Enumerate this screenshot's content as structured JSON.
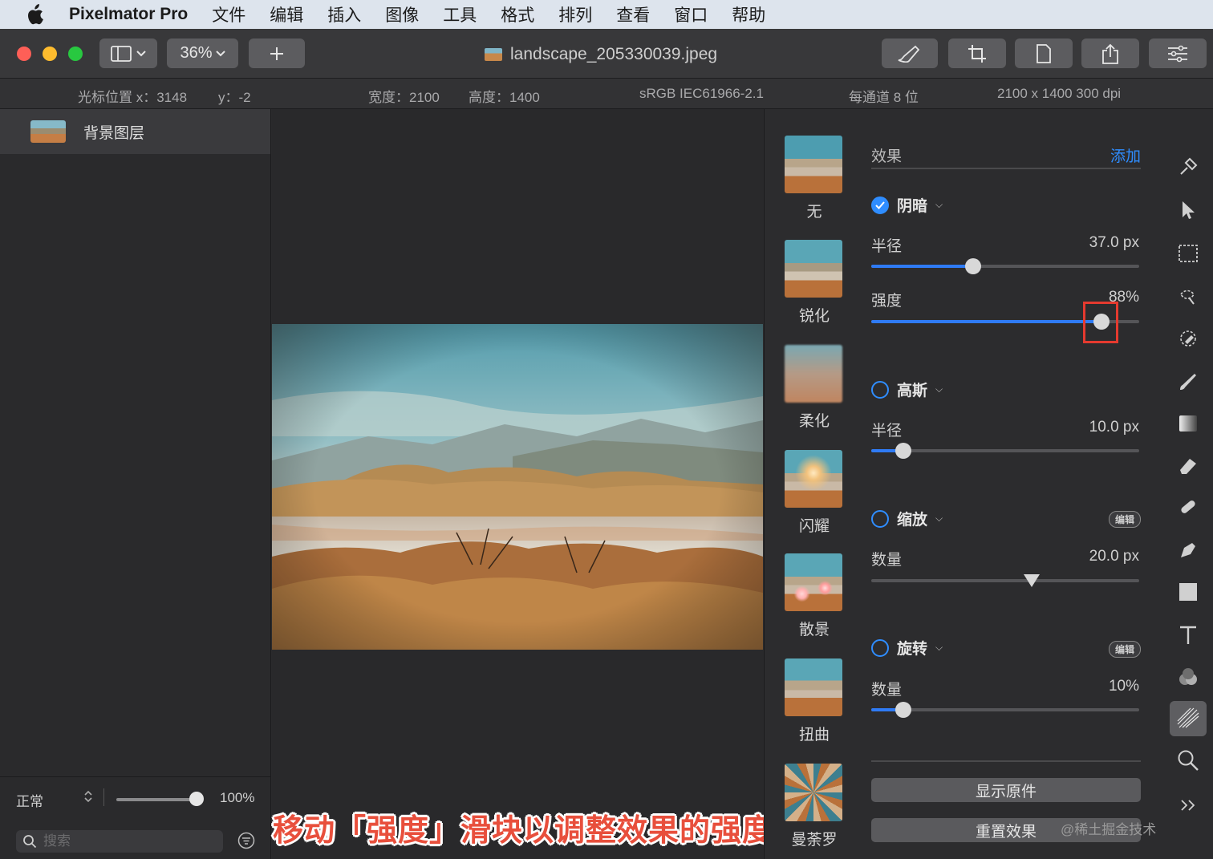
{
  "menubar": {
    "app_name": "Pixelmator Pro",
    "items": [
      "文件",
      "编辑",
      "插入",
      "图像",
      "工具",
      "格式",
      "排列",
      "查看",
      "窗口",
      "帮助"
    ]
  },
  "toolbar": {
    "zoom": "36%",
    "document_title": "landscape_205330039.jpeg"
  },
  "infobar": {
    "cursor_x": "光标位置 x：3148",
    "cursor_y": "y：-2",
    "width": "宽度：2100",
    "height": "高度：1400",
    "color_profile": "sRGB IEC61966-2.1",
    "bit_depth": "每通道 8 位",
    "dimensions": "2100 x 1400 300 dpi"
  },
  "layers": {
    "items": [
      {
        "name": "背景图层"
      }
    ],
    "blend_mode": "正常",
    "opacity": "100%",
    "opacity_value": 1.0,
    "search_placeholder": "搜索"
  },
  "effects_browser": {
    "items": [
      "无",
      "锐化",
      "柔化",
      "闪耀",
      "散景",
      "扭曲",
      "曼荼罗"
    ]
  },
  "effects_panel": {
    "title": "效果",
    "add_label": "添加",
    "effects": [
      {
        "name": "阴暗",
        "enabled": true,
        "params": [
          {
            "label": "半径",
            "value": "37.0 px",
            "fraction": 0.38
          },
          {
            "label": "强度",
            "value": "88%",
            "fraction": 0.86
          }
        ]
      },
      {
        "name": "高斯",
        "enabled": false,
        "params": [
          {
            "label": "半径",
            "value": "10.0 px",
            "fraction": 0.12
          }
        ]
      },
      {
        "name": "缩放",
        "enabled": false,
        "edit_label": "编辑",
        "params": [
          {
            "label": "数量",
            "value": "20.0 px",
            "fraction": 0.6
          }
        ]
      },
      {
        "name": "旋转",
        "enabled": false,
        "edit_label": "编辑",
        "params": [
          {
            "label": "数量",
            "value": "10%",
            "fraction": 0.12
          }
        ]
      }
    ],
    "show_original": "显示原件",
    "reset_effects": "重置效果"
  },
  "caption": "移动「强度」滑块以调整效果的强度",
  "watermark": "@稀土掘金技术社区",
  "colors": {
    "accent": "#2f7bf5",
    "highlight": "#e53a2f",
    "caption": "#e84f3c",
    "traffic_red": "#fe5f57",
    "traffic_yellow": "#febc2e",
    "traffic_green": "#28c840"
  }
}
